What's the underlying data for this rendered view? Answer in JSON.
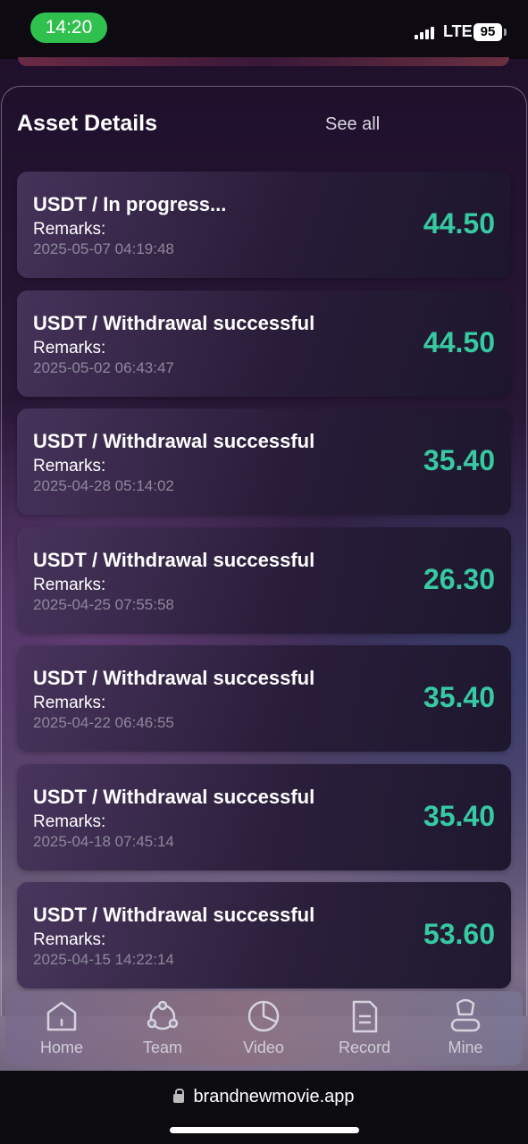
{
  "status_bar": {
    "time": "14:20",
    "network": "LTE",
    "battery": "95"
  },
  "asset_details": {
    "title": "Asset Details",
    "see_all": "See all",
    "items": [
      {
        "title": "USDT / In progress...",
        "remarks": "Remarks:",
        "date": "2025-05-07 04:19:48",
        "amount": "44.50"
      },
      {
        "title": "USDT / Withdrawal successful",
        "remarks": "Remarks:",
        "date": "2025-05-02 06:43:47",
        "amount": "44.50"
      },
      {
        "title": "USDT / Withdrawal successful",
        "remarks": "Remarks:",
        "date": "2025-04-28 05:14:02",
        "amount": "35.40"
      },
      {
        "title": "USDT / Withdrawal successful",
        "remarks": "Remarks:",
        "date": "2025-04-25 07:55:58",
        "amount": "26.30"
      },
      {
        "title": "USDT / Withdrawal successful",
        "remarks": "Remarks:",
        "date": "2025-04-22 06:46:55",
        "amount": "35.40"
      },
      {
        "title": "USDT / Withdrawal successful",
        "remarks": "Remarks:",
        "date": "2025-04-18 07:45:14",
        "amount": "35.40"
      },
      {
        "title": "USDT / Withdrawal successful",
        "remarks": "Remarks:",
        "date": "2025-04-15 14:22:14",
        "amount": "53.60"
      }
    ]
  },
  "bottom_nav": {
    "items": [
      {
        "label": "Home",
        "icon": "home-icon"
      },
      {
        "label": "Team",
        "icon": "team-icon"
      },
      {
        "label": "Video",
        "icon": "video-icon"
      },
      {
        "label": "Record",
        "icon": "record-icon"
      },
      {
        "label": "Mine",
        "icon": "mine-icon"
      }
    ]
  },
  "browser": {
    "url": "brandnewmovie.app"
  },
  "colors": {
    "amount": "#37c9a2",
    "time_pill": "#30c04e"
  }
}
